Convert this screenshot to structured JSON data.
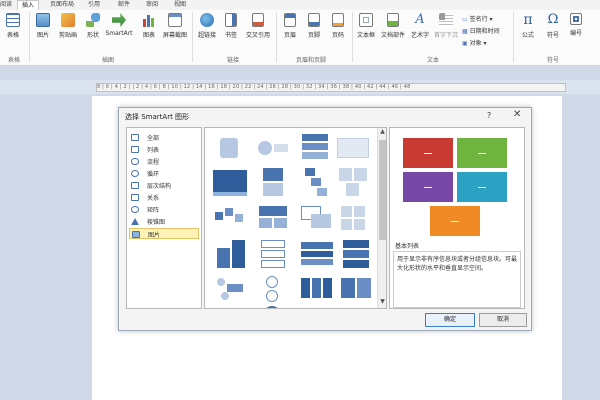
{
  "menu": {
    "tabs": [
      "阅读",
      "插入",
      "页面布局",
      "引用",
      "邮件",
      "审阅",
      "视图"
    ],
    "active": "插入"
  },
  "ribbon": {
    "buttons": [
      {
        "label": "表格",
        "icon": "table-icon"
      },
      {
        "label": "图片",
        "icon": "picture-icon"
      },
      {
        "label": "剪贴画",
        "icon": "clipart-icon"
      },
      {
        "label": "形状",
        "icon": "shapes-icon"
      },
      {
        "label": "SmartArt",
        "icon": "smartart-icon"
      },
      {
        "label": "图表",
        "icon": "chart-icon"
      },
      {
        "label": "屏幕截图",
        "icon": "screenshot-icon"
      },
      {
        "label": "超链接",
        "icon": "hyperlink-icon"
      },
      {
        "label": "书签",
        "icon": "bookmark-icon"
      },
      {
        "label": "交叉引用",
        "icon": "crossref-icon"
      },
      {
        "label": "页眉",
        "icon": "header-icon"
      },
      {
        "label": "页脚",
        "icon": "footer-icon"
      },
      {
        "label": "页码",
        "icon": "pagenumber-icon"
      },
      {
        "label": "文本框",
        "icon": "textbox-icon"
      },
      {
        "label": "文档部件",
        "icon": "quickparts-icon"
      },
      {
        "label": "艺术字",
        "icon": "wordart-icon"
      },
      {
        "label": "首字下沉",
        "icon": "dropcap-icon"
      },
      {
        "label": "公式",
        "icon": "equation-icon"
      },
      {
        "label": "符号",
        "icon": "symbol-icon"
      },
      {
        "label": "编号",
        "icon": "numbering-icon"
      }
    ],
    "small_items": [
      "签名行",
      "日期和时间",
      "对象"
    ],
    "groups": [
      "表格",
      "插图",
      "链接",
      "页眉和页脚",
      "文本",
      "符号"
    ],
    "equation_glyph": "π",
    "symbol_glyph": "Ω",
    "wordart_glyph": "A"
  },
  "ruler": {
    "numbers": "8 | 6 | 4 | 2 |  | 2 | 4 | 6 | 8 | 10 | 12 | 14 | 16 | 18 | 20 | 22 | 24 | 26 | 28 | 30 | 32 | 34 | 36 | 38 | 40 | 42 | 44 | 46 | 48"
  },
  "dialog": {
    "title": "选择 SmartArt 图形",
    "help": "?",
    "close": "✕",
    "categories": [
      "全部",
      "列表",
      "流程",
      "循环",
      "层次结构",
      "关系",
      "矩阵",
      "棱锥图",
      "图片"
    ],
    "selected_category": "图片",
    "preview": {
      "name": "基本列表",
      "description": "用于显示非有序信息块或者分组信息块。可最大化形状的水平和垂直显示空间。",
      "colors": [
        "#c83a32",
        "#6fb43f",
        "#7747a5",
        "#2ba1c4",
        "#f08a24"
      ]
    },
    "ok": "确定",
    "cancel": "取消"
  },
  "colors": {
    "accent": "#4a74b0",
    "selection": "#fff3b8"
  }
}
